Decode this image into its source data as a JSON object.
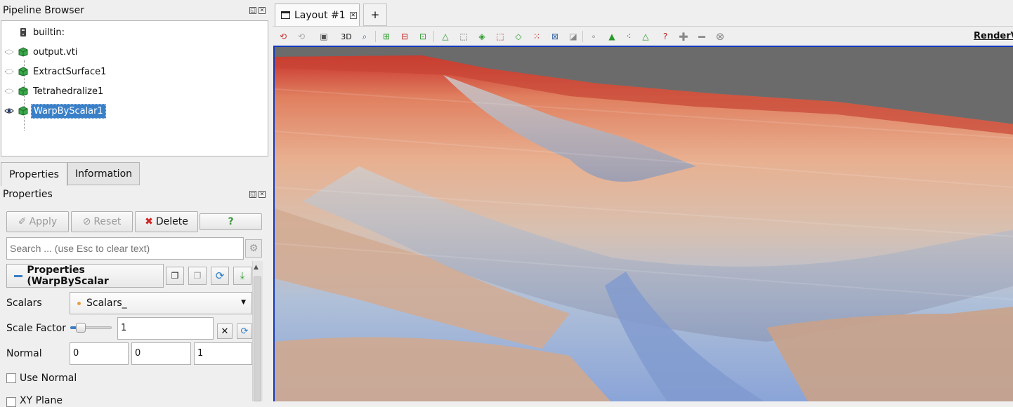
{
  "pipeline_browser": {
    "title": "Pipeline Browser",
    "items": [
      {
        "label": "builtin:"
      },
      {
        "label": "output.vti"
      },
      {
        "label": "ExtractSurface1"
      },
      {
        "label": "Tetrahedralize1"
      },
      {
        "label": "WarpByScalar1"
      }
    ]
  },
  "tabs": {
    "properties": "Properties",
    "information": "Information"
  },
  "properties_panel": {
    "title": "Properties",
    "apply_label": "Apply",
    "reset_label": "Reset",
    "delete_label": "Delete",
    "help_label": "?",
    "search_placeholder": "Search ... (use Esc to clear text)",
    "section_title": "Properties (WarpByScalar",
    "scalars": {
      "label": "Scalars",
      "value": "Scalars_"
    },
    "scale_factor": {
      "label": "Scale Factor",
      "value": "1",
      "slider_fraction": 0.2
    },
    "normal": {
      "label": "Normal",
      "x": "0",
      "y": "0",
      "z": "1"
    },
    "use_normal": {
      "label": "Use Normal",
      "checked": false
    },
    "xy_plane": {
      "label": "XY Plane",
      "checked": false
    }
  },
  "layout": {
    "tab_label": "Layout #1",
    "add_tab_label": "+",
    "toolbar_3d_label": "3D",
    "render_view_label": "RenderV"
  },
  "colors": {
    "selection": "#3a80c8",
    "viewport_border": "#1038c0",
    "background": "#6b6b6b"
  }
}
